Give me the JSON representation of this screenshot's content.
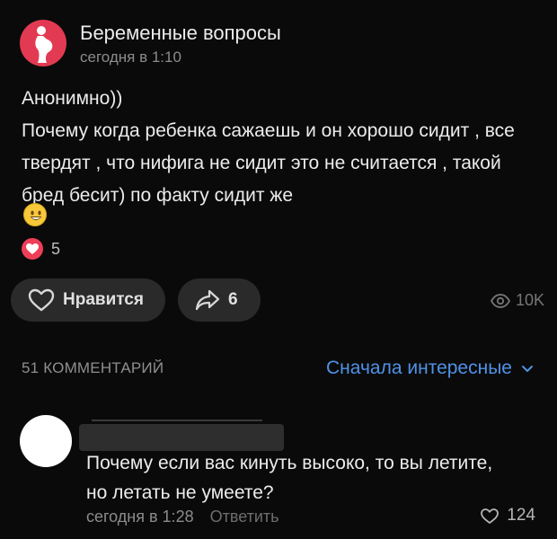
{
  "post": {
    "group_name": "Беременные вопросы",
    "time": "сегодня в 1:10",
    "text_line1": "Анонимно))",
    "text_line2": "Почему когда ребенка сажаешь и он хорошо сидит , все твердят , что нифига не сидит это не считается , такой бред бесит) по факту сидит же",
    "emoji": "smiling-face-emoji",
    "reaction_count": "5"
  },
  "actions": {
    "like_label": "Нравится",
    "share_count": "6",
    "views": "10K"
  },
  "comments": {
    "count_label": "51 КОММЕНТАРИЙ",
    "sort_label": "Сначала интересные",
    "first": {
      "text": "Почему если вас кинуть высоко, то вы летите, но летать не умеете?",
      "time": "сегодня в 1:28",
      "reply_label": "Ответить",
      "likes": "124"
    }
  },
  "colors": {
    "background": "#0a0a0a",
    "accent_blue": "#4f92e6",
    "reaction_red": "#ef3e58",
    "avatar_pink": "#e23a52"
  }
}
